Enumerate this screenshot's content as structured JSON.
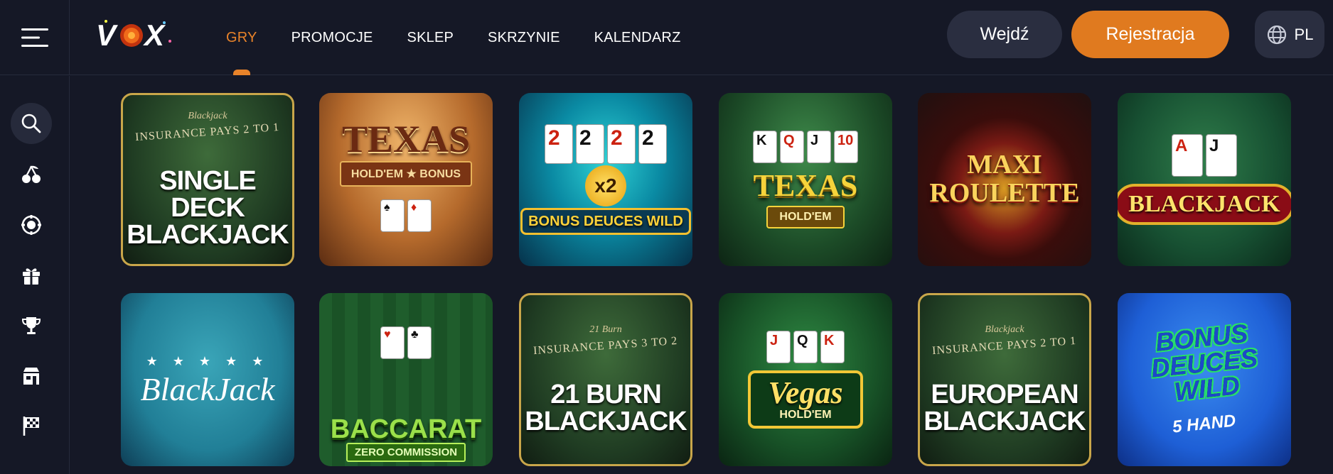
{
  "header": {
    "logo_text": "VOX",
    "nav": [
      {
        "label": "GRY",
        "active": true
      },
      {
        "label": "PROMOCJE",
        "active": false
      },
      {
        "label": "SKLEP",
        "active": false
      },
      {
        "label": "SKRZYNIE",
        "active": false
      },
      {
        "label": "KALENDARZ",
        "active": false
      }
    ],
    "login_label": "Wejdź",
    "register_label": "Rejestracja",
    "language": "PL"
  },
  "sidebar": {
    "icons": [
      "search-icon",
      "cherries-icon",
      "chip-icon",
      "gift-icon",
      "trophy-icon",
      "shop-icon",
      "flag-icon"
    ]
  },
  "games": [
    {
      "title": "SINGLE DECK BLACKJACK",
      "top_text": "Blackjack",
      "strip": "INSURANCE PAYS 2 TO 1"
    },
    {
      "title": "TEXAS",
      "subtitle": "HOLD'EM ★ BONUS"
    },
    {
      "title": "BONUS DEUCES WILD",
      "badge": "x2"
    },
    {
      "title": "TEXAS",
      "subtitle": "HOLD'EM"
    },
    {
      "title": "MAXI ROULETTE"
    },
    {
      "title": "BLACKJACK"
    },
    {
      "title": "BlackJack"
    },
    {
      "title": "BACCARAT",
      "subtitle": "ZERO COMMISSION"
    },
    {
      "title": "21 BURN BLACKJACK",
      "top_text": "21 Burn",
      "strip": "INSURANCE PAYS 3 TO 2"
    },
    {
      "title": "Vegas",
      "subtitle": "HOLD'EM"
    },
    {
      "title": "EUROPEAN BLACKJACK",
      "top_text": "Blackjack",
      "strip": "INSURANCE PAYS 2 TO 1"
    },
    {
      "title": "BONUS DEUCES WILD",
      "subtitle": "5 HAND"
    }
  ],
  "colors": {
    "background": "#151826",
    "accent": "#e07a1f",
    "active_nav": "#e8832a",
    "button_dark": "#2a2e40"
  }
}
